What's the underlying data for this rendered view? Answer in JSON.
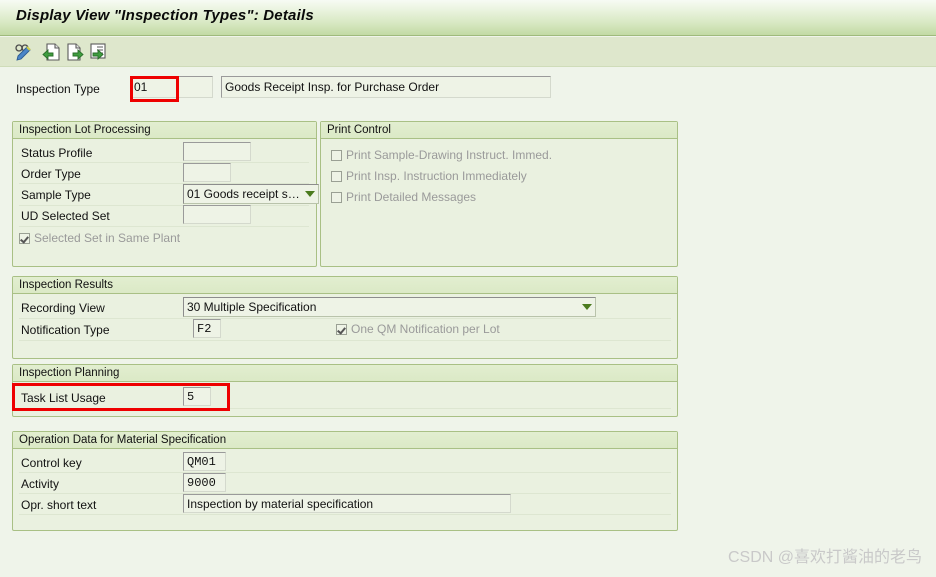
{
  "window": {
    "title": "Display View \"Inspection Types\": Details"
  },
  "toolbar": {
    "buttons": [
      {
        "name": "display-change-icon",
        "tooltip": "Display <-> Change"
      },
      {
        "name": "previous-entry-icon",
        "tooltip": "Previous Entry"
      },
      {
        "name": "next-entry-icon",
        "tooltip": "Next Entry"
      },
      {
        "name": "details-icon",
        "tooltip": "Details"
      }
    ]
  },
  "header": {
    "inspection_type_label": "Inspection Type",
    "inspection_type_value": "01",
    "inspection_type_description": "Goods Receipt Insp. for Purchase Order"
  },
  "groups": {
    "inspection_lot_processing": {
      "title": "Inspection Lot Processing",
      "fields": {
        "status_profile_label": "Status Profile",
        "status_profile_value": "",
        "order_type_label": "Order Type",
        "order_type_value": "",
        "sample_type_label": "Sample Type",
        "sample_type_value": "01 Goods receipt s…",
        "ud_selected_set_label": "UD Selected Set",
        "ud_selected_set_value": ""
      },
      "checkbox": {
        "label": "Selected Set in Same Plant",
        "checked": true,
        "disabled": true
      }
    },
    "print_control": {
      "title": "Print Control",
      "checkboxes": [
        {
          "label": "Print Sample-Drawing Instruct. Immed.",
          "checked": false,
          "disabled": true
        },
        {
          "label": "Print Insp. Instruction Immediately",
          "checked": false,
          "disabled": true
        },
        {
          "label": "Print Detailed Messages",
          "checked": false,
          "disabled": true
        }
      ]
    },
    "inspection_results": {
      "title": "Inspection Results",
      "fields": {
        "recording_view_label": "Recording View",
        "recording_view_value": "30 Multiple Specification",
        "notification_type_label": "Notification Type",
        "notification_type_value": "F2"
      },
      "checkbox": {
        "label": "One QM Notification per Lot",
        "checked": true,
        "disabled": true
      }
    },
    "inspection_planning": {
      "title": "Inspection Planning",
      "fields": {
        "task_list_usage_label": "Task List Usage",
        "task_list_usage_value": "5"
      }
    },
    "operation_data": {
      "title": "Operation Data for Material Specification",
      "fields": {
        "control_key_label": "Control key",
        "control_key_value": "QM01",
        "activity_label": "Activity",
        "activity_value": "9000",
        "opr_short_text_label": "Opr. short text",
        "opr_short_text_value": "Inspection by material specification"
      }
    }
  },
  "annotations": {
    "highlight_color": "#ee0000",
    "highlighted_fields": [
      "inspection_type_value",
      "task_list_usage_row"
    ]
  },
  "watermark": {
    "text": "CSDN @喜欢打酱油的老鸟"
  }
}
